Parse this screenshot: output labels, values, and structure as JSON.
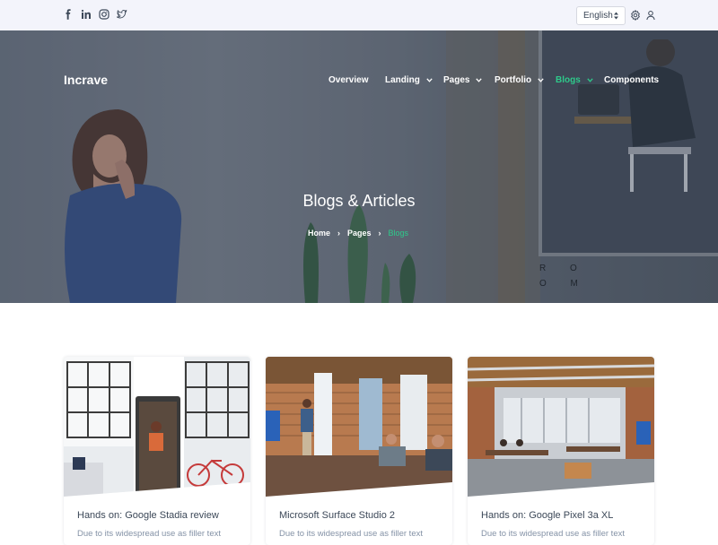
{
  "topbar": {
    "social": [
      {
        "icon": "facebook-icon"
      },
      {
        "icon": "linkedin-icon"
      },
      {
        "icon": "instagram-icon"
      },
      {
        "icon": "twitter-icon"
      }
    ],
    "language": "English",
    "settings_icon": "gear-icon",
    "account_icon": "user-icon"
  },
  "header": {
    "brand": "Incrave",
    "nav": [
      {
        "label": "Overview",
        "dropdown": false
      },
      {
        "label": "Landing",
        "dropdown": true
      },
      {
        "label": "Pages",
        "dropdown": true
      },
      {
        "label": "Portfolio",
        "dropdown": true
      },
      {
        "label": "Blogs",
        "dropdown": true,
        "active": true
      },
      {
        "label": "Components",
        "dropdown": false
      }
    ]
  },
  "hero": {
    "title": "Blogs & Articles",
    "breadcrumb": [
      "Home",
      "Pages",
      "Blogs"
    ],
    "room_sign": "R O O M"
  },
  "posts": [
    {
      "title": "Hands on: Google Stadia review",
      "excerpt": "Due to its widespread use as filler text"
    },
    {
      "title": "Microsoft Surface Studio 2",
      "excerpt": "Due to its widespread use as filler text"
    },
    {
      "title": "Hands on: Google Pixel 3a XL",
      "excerpt": "Due to its widespread use as filler text"
    }
  ],
  "colors": {
    "accent": "#2eca8b",
    "topbar": "#f3f4fb",
    "heading": "#3c4858",
    "muted": "#8492a6"
  }
}
